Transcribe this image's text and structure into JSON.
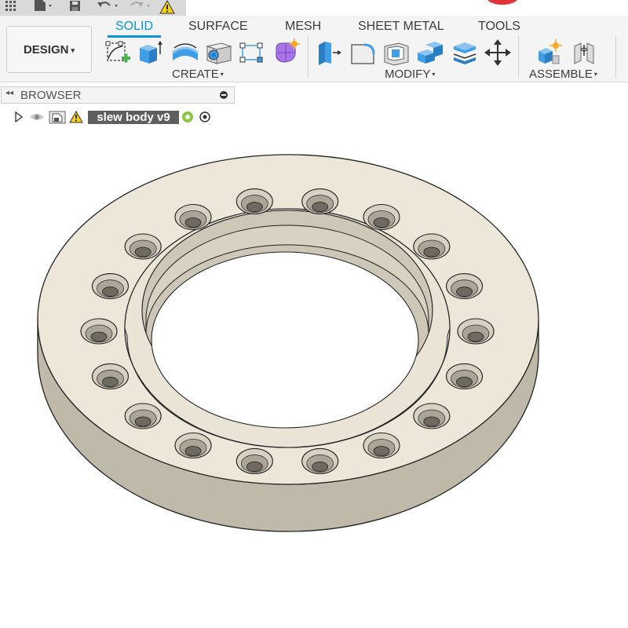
{
  "tabs": [
    {
      "label": "SOLID",
      "active": true
    },
    {
      "label": "SURFACE",
      "active": false
    },
    {
      "label": "MESH",
      "active": false
    },
    {
      "label": "SHEET METAL",
      "active": false
    },
    {
      "label": "TOOLS",
      "active": false
    }
  ],
  "workspace": {
    "label": "DESIGN",
    "caret": "▾"
  },
  "groups": {
    "create": {
      "label": "CREATE",
      "caret": "▾"
    },
    "modify": {
      "label": "MODIFY",
      "caret": "▾"
    },
    "assemble": {
      "label": "ASSEMBLE",
      "caret": "▾"
    }
  },
  "browser": {
    "title": "BROWSER",
    "collapse": "◂◂"
  },
  "tree": {
    "component_name": "slew body v9"
  },
  "model": {
    "bolt_hole_count": 18,
    "body_color": "#ece7d9"
  },
  "colors": {
    "accent": "#0696d7",
    "warning": "#f7d117",
    "tool_blue": "#3f9ee6"
  }
}
